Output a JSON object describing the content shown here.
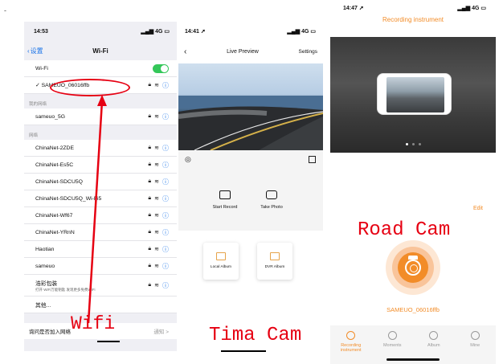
{
  "top_mark": "-",
  "wifi_panel": {
    "time": "14:53",
    "signal": "4G",
    "back_label": "设置",
    "title": "Wi-Fi",
    "wifi_row_label": "Wi-Fi",
    "connected_network": "SAMEUO_06016ffb",
    "section_my_networks": "我的网络",
    "my_networks": [
      "sameuo_5G"
    ],
    "section_networks": "网络",
    "networks": [
      "ChinaNet-2ZDE",
      "ChinaNet-Es5C",
      "ChinaNet-SDCU5Q",
      "ChinaNet-SDCU5Q_Wi-Fi5",
      "ChinaNet-Wf67",
      "ChinaNet-YRnN",
      "Haotian",
      "sameuo"
    ],
    "special_network": {
      "name": "浩彩包装",
      "subtitle": "打开 WiFi万能钥匙 发现更多免费WiFi"
    },
    "other_label": "其他...",
    "ask_join_label": "询问是否加入网络",
    "ask_join_value": "通知 >",
    "annotation": "Wifi",
    "accent": "#e60012",
    "toggle_color": "#34c759"
  },
  "tima_panel": {
    "time": "14:41",
    "signal": "4G",
    "title": "Live Preview",
    "settings_label": "Settings",
    "actions": [
      {
        "label": "Start Record",
        "icon": "video-camera-icon"
      },
      {
        "label": "Take Photo",
        "icon": "camera-icon"
      }
    ],
    "albums": [
      {
        "label": "Local Album",
        "icon": "folder-download-icon"
      },
      {
        "label": "DVR Album",
        "icon": "folder-lock-icon"
      }
    ],
    "annotation": "Tima Cam"
  },
  "road_panel": {
    "time": "14:47",
    "signal": "4G",
    "title": "Recording instrument",
    "edit_label": "Edit",
    "device_name": "SAMEUO_06016ffb",
    "annotation": "Road Cam",
    "tabs": [
      {
        "label": "Recording instrument",
        "active": true
      },
      {
        "label": "Moments",
        "active": false
      },
      {
        "label": "Album",
        "active": false
      },
      {
        "label": "Mine",
        "active": false
      }
    ],
    "accent": "#f28c28"
  }
}
